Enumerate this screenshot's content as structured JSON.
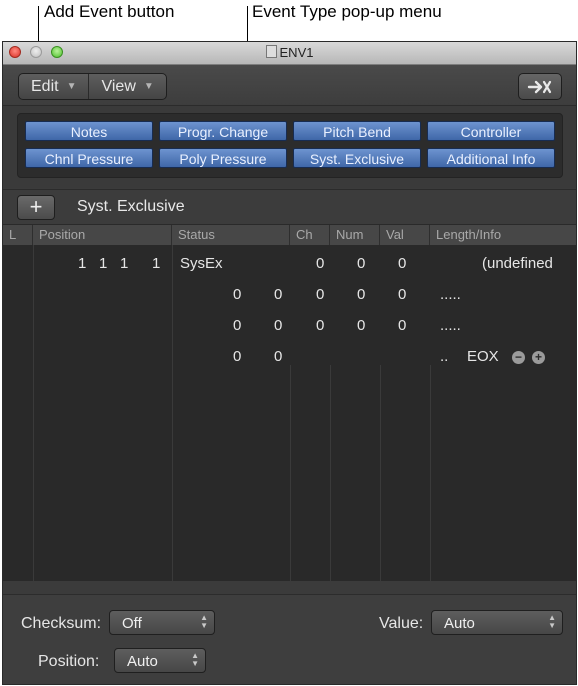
{
  "callouts": {
    "add_event": "Add Event button",
    "event_type": "Event Type pop-up menu"
  },
  "window": {
    "title": "ENV1"
  },
  "toolbar": {
    "edit_label": "Edit",
    "view_label": "View"
  },
  "filters": [
    "Notes",
    "Progr. Change",
    "Pitch Bend",
    "Controller",
    "Chnl Pressure",
    "Poly Pressure",
    "Syst. Exclusive",
    "Additional Info"
  ],
  "add_bar": {
    "add_symbol": "+",
    "event_type": "Syst. Exclusive"
  },
  "columns": [
    "L",
    "Position",
    "Status",
    "Ch",
    "Num",
    "Val",
    "Length/Info"
  ],
  "event": {
    "position": [
      "1",
      "1",
      "1",
      "1"
    ],
    "status": "SysEx",
    "ch": "0",
    "num": "0",
    "val": "0",
    "info": "(undefined"
  },
  "sysex_rows": [
    {
      "values": [
        "0",
        "0",
        "0",
        "0",
        "0"
      ],
      "info": "....."
    },
    {
      "values": [
        "0",
        "0",
        "0",
        "0",
        "0"
      ],
      "info": "....."
    },
    {
      "values": [
        "0",
        "0"
      ],
      "info": "..",
      "end": "EOX"
    }
  ],
  "bottom": {
    "checksum_label": "Checksum:",
    "checksum_value": "Off",
    "value_label": "Value:",
    "value_value": "Auto",
    "position_label": "Position:",
    "position_value": "Auto"
  },
  "colors": {
    "filter_blue": "#4f78bb",
    "window_bg": "#3b3b3b",
    "list_bg": "#292929"
  }
}
